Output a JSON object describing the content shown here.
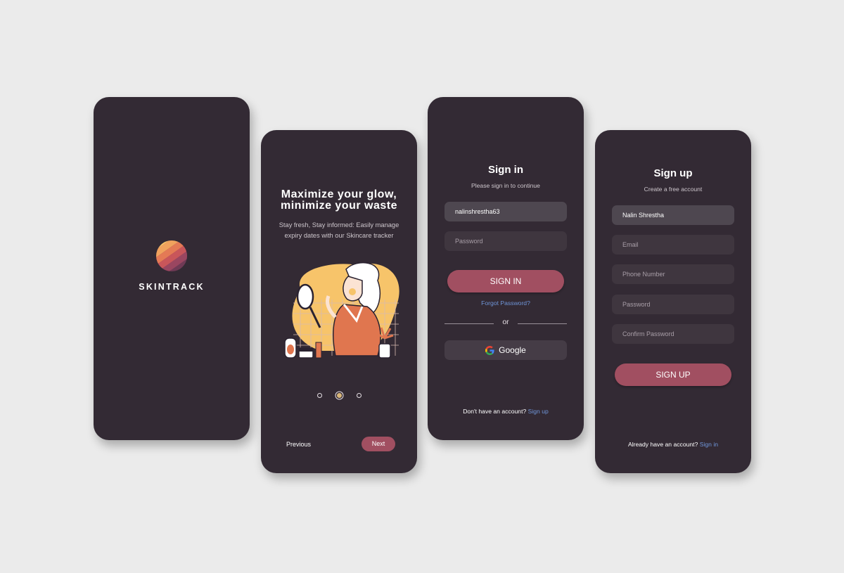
{
  "splash": {
    "brand": "SKINTRACK"
  },
  "onboarding": {
    "title_line1": "Maximize your glow,",
    "title_line2": "minimize your waste",
    "subtitle_line1": "Stay fresh, Stay informed: Easily manage",
    "subtitle_line2": "expiry dates with our Skincare tracker",
    "pager": {
      "total": 3,
      "active": 2
    },
    "previous_label": "Previous",
    "next_label": "Next"
  },
  "signin": {
    "title": "Sign in",
    "subtitle": "Please sign in to continue",
    "username_value": "nalinshrestha63",
    "password_placeholder": "Password",
    "button_label": "SIGN IN",
    "forgot_label": "Forgot Password?",
    "or_label": "or",
    "google_label": "Google",
    "footer_text": "Don't have an account?",
    "footer_link": "Sign up"
  },
  "signup": {
    "title": "Sign up",
    "subtitle": "Create a free account",
    "name_value": "Nalin Shrestha",
    "email_placeholder": "Email",
    "phone_placeholder": "Phone Number",
    "password_placeholder": "Password",
    "confirm_placeholder": "Confirm Password",
    "button_label": "SIGN UP",
    "footer_text": "Already have an account?",
    "footer_link": "Sign in"
  },
  "colors": {
    "background": "#ebebeb",
    "phone": "#332a34",
    "accent": "#a14f61",
    "link": "#6f95d8",
    "illustration_yellow": "#f7c46a",
    "illustration_orange": "#e0764f"
  },
  "icons": [
    "striped-sun-logo-icon",
    "google-icon"
  ]
}
